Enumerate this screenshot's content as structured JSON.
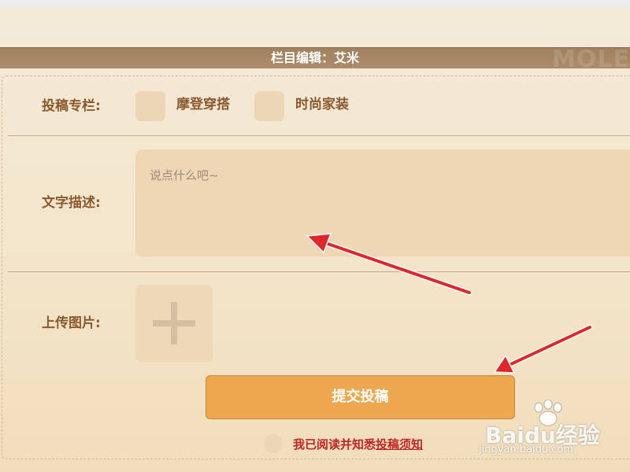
{
  "header": {
    "title": "栏目编辑：艾米",
    "logo_text": "MOLE"
  },
  "form": {
    "column": {
      "label": "投稿专栏:",
      "options": [
        {
          "label": "摩登穿搭"
        },
        {
          "label": "时尚家装"
        }
      ]
    },
    "description": {
      "label": "文字描述:",
      "placeholder": "说点什么吧~"
    },
    "upload": {
      "label": "上传图片:",
      "icon": "plus-icon"
    },
    "submit_label": "提交投稿",
    "agree": {
      "prefix": "我已阅读并知悉",
      "link": "投稿须知"
    }
  },
  "watermark": {
    "text": "Baidu经验",
    "sub": "jingyan.baidu.com"
  },
  "annotations": {
    "arrow_color": "#e0262b"
  }
}
